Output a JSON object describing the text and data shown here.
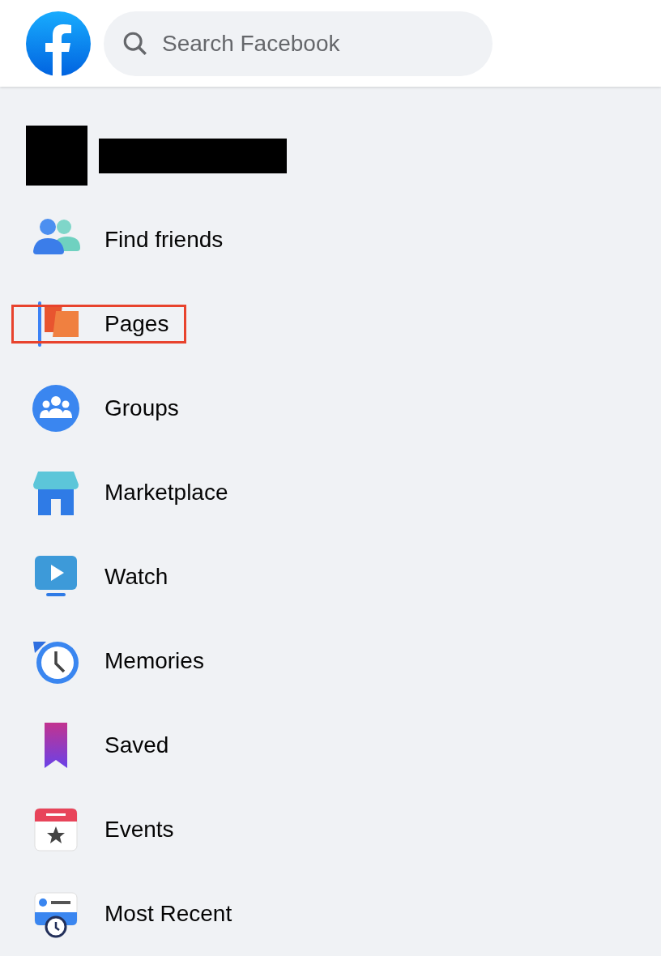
{
  "header": {
    "search": {
      "placeholder": "Search Facebook"
    }
  },
  "profile": {
    "redacted": true
  },
  "menu": [
    {
      "kind": "friends",
      "label": "Find friends",
      "highlighted": false
    },
    {
      "kind": "pages",
      "label": "Pages",
      "highlighted": true
    },
    {
      "kind": "groups",
      "label": "Groups",
      "highlighted": false
    },
    {
      "kind": "marketplace",
      "label": "Marketplace",
      "highlighted": false
    },
    {
      "kind": "watch",
      "label": "Watch",
      "highlighted": false
    },
    {
      "kind": "memories",
      "label": "Memories",
      "highlighted": false
    },
    {
      "kind": "saved",
      "label": "Saved",
      "highlighted": false
    },
    {
      "kind": "events",
      "label": "Events",
      "highlighted": false
    },
    {
      "kind": "recent",
      "label": "Most Recent",
      "highlighted": false
    }
  ]
}
